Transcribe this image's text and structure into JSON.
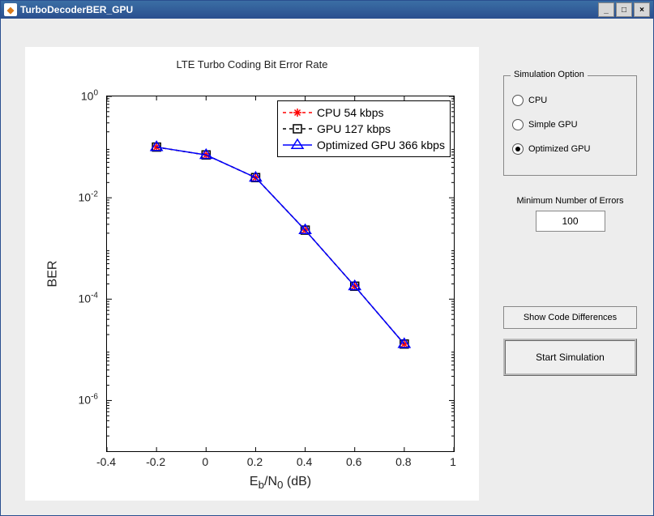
{
  "window": {
    "title": "TurboDecoderBER_GPU",
    "icon_glyph": "◆"
  },
  "chart_data": {
    "type": "line",
    "title": "LTE Turbo Coding Bit Error Rate",
    "xlabel": "E_b/N_0 (dB)",
    "ylabel": "BER",
    "xlim": [
      -0.4,
      1.0
    ],
    "ylim_log10": [
      -7,
      0
    ],
    "xticks": [
      -0.4,
      -0.2,
      0,
      0.2,
      0.4,
      0.6,
      0.8,
      1
    ],
    "ytick_exponents": [
      0,
      -2,
      -4,
      -6
    ],
    "categories": [
      -0.2,
      0.0,
      0.2,
      0.4,
      0.6,
      0.8
    ],
    "series": [
      {
        "name": "CPU 54 kbps",
        "color": "#ff0000",
        "dash": "4,4",
        "marker": "asterisk",
        "values": [
          0.1,
          0.07,
          0.025,
          0.0023,
          0.00018,
          1.3e-05
        ]
      },
      {
        "name": "GPU 127 kbps",
        "color": "#000000",
        "dash": "4,4",
        "marker": "square",
        "values": [
          0.1,
          0.07,
          0.025,
          0.0023,
          0.00018,
          1.3e-05
        ]
      },
      {
        "name": "Optimized GPU 366 kbps",
        "color": "#0000ff",
        "dash": "",
        "marker": "triangle",
        "values": [
          0.1,
          0.07,
          0.025,
          0.0023,
          0.00018,
          1.3e-05
        ]
      }
    ]
  },
  "sim_option": {
    "group_label": "Simulation Option",
    "options": [
      {
        "label": "CPU",
        "selected": false
      },
      {
        "label": "Simple GPU",
        "selected": false
      },
      {
        "label": "Optimized GPU",
        "selected": true
      }
    ]
  },
  "min_errors": {
    "label": "Minimum Number of Errors",
    "value": "100"
  },
  "buttons": {
    "diff": "Show Code Differences",
    "start": "Start Simulation"
  }
}
